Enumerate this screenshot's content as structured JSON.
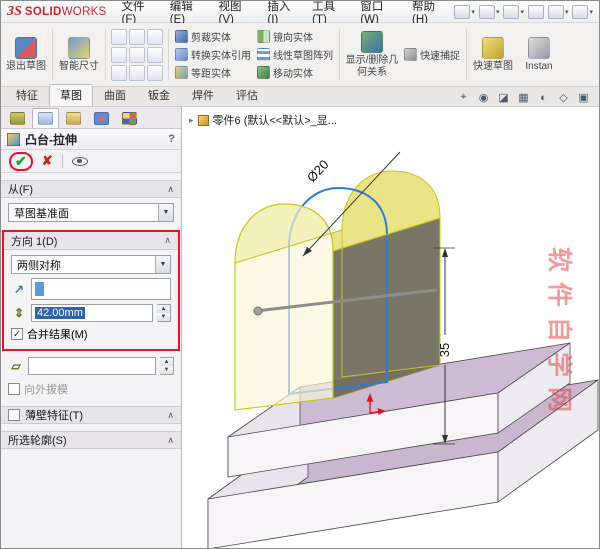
{
  "titlebar": {
    "logo_mark": "ЗS",
    "logo_solid": "SOLID",
    "logo_works": "WORKS",
    "menus": [
      "文件(F)",
      "编辑(E)",
      "视图(V)",
      "插入(I)",
      "工具(T)",
      "窗口(W)",
      "帮助(H)"
    ]
  },
  "ribbon": {
    "exit_sketch": "退出草图",
    "smart_dimension": "智能尺寸",
    "trim": "剪裁实体",
    "convert": "转换实体引用",
    "offset": "等距实体",
    "mirror": "镜向实体",
    "pattern": "线性草图阵列",
    "move": "移动实体",
    "relations": "显示/删除几何关系",
    "snaps": "快速捕捉",
    "rapid": "快速草图",
    "instant": "Instan"
  },
  "tabs": {
    "items": [
      "特征",
      "草图",
      "曲面",
      "钣金",
      "焊件",
      "评估"
    ],
    "active": "草图"
  },
  "panel": {
    "title": "凸台-拉伸",
    "from": {
      "header": "从(F)",
      "value": "草图基准面"
    },
    "direction1": {
      "header": "方向 1(D)",
      "end_condition": "两侧对称",
      "depth": "42.00mm",
      "merge": "合并结果(M)"
    },
    "draft_outward": "向外拔模",
    "thin": {
      "header": "薄壁特征(T)"
    },
    "contours": {
      "header": "所选轮廓(S)"
    }
  },
  "graphics": {
    "tree_label": "零件6 (默认<<默认>_显...",
    "dim_diameter": "Ø20",
    "dim_height": "35",
    "watermark": "软件自学网"
  },
  "colors": {
    "accent_red": "#e8112d",
    "logo_red": "#d2232a",
    "sketch_blue": "#2e7cd6",
    "solid_yellow": "#e9e380",
    "plate_lavender": "#c9b7cf",
    "selection_blue": "#2f62ad"
  },
  "icons": {
    "caret": "▼",
    "titlebar_caret": "▾",
    "collapse": "∧",
    "check": "✔",
    "cross": "✘",
    "check_small": "✓",
    "spin_up": "▲",
    "spin_down": "▼",
    "dir_arrow": "↗",
    "depth_glyph": "⇕",
    "draft_glyph": "▱",
    "help": "?",
    "tree_expand": "▸",
    "hud": [
      "⌖",
      "◉",
      "◪",
      "▦",
      "◐",
      "◇",
      "▣"
    ]
  }
}
